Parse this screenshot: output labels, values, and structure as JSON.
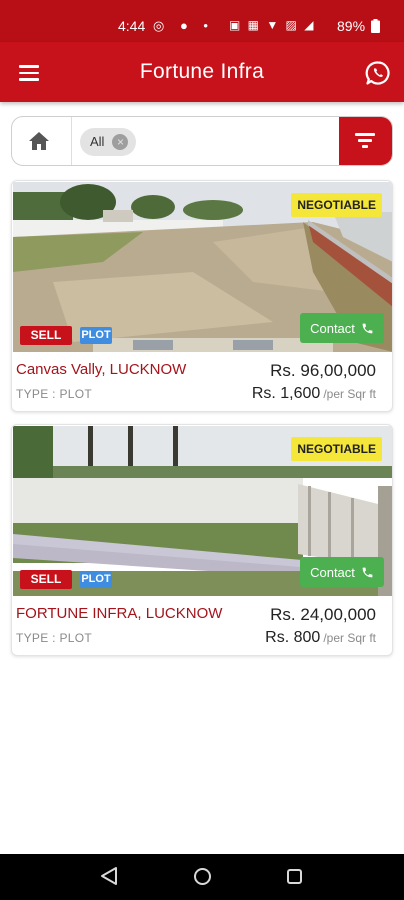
{
  "status_bar": {
    "time": "4:44",
    "left_icons": "◎ ● •",
    "right_icons": "▣ ▦ ▼ ▨ ◢",
    "battery": "89%"
  },
  "app_bar": {
    "title": "Fortune Infra"
  },
  "filter": {
    "chip_label": "All",
    "chip_close": "×"
  },
  "listings": [
    {
      "negotiable": "NEGOTIABLE",
      "sell": "SELL",
      "plot": "PLOT",
      "contact": "Contact",
      "title": "Canvas Vally, LUCKNOW",
      "type": "TYPE : PLOT",
      "price": "Rs. 96,00,000",
      "rate": "Rs. 1,600",
      "rate_unit": "/per Sqr ft"
    },
    {
      "negotiable": "NEGOTIABLE",
      "sell": "SELL",
      "plot": "PLOT",
      "contact": "Contact",
      "title": "FORTUNE INFRA, LUCKNOW",
      "type": "TYPE : PLOT",
      "price": "Rs. 24,00,000",
      "rate": "Rs. 800",
      "rate_unit": "/per Sqr ft"
    }
  ],
  "colors": {
    "brand_red": "#c8121b",
    "status_red": "#b80f16",
    "contact_green": "#4caf50",
    "negotiable_yellow": "#f5e63a",
    "plot_blue": "#3f8de0"
  },
  "icons": {
    "menu": "menu-icon",
    "whatsapp": "whatsapp-icon",
    "home": "home-icon",
    "filter": "filter-icon",
    "phone": "phone-icon",
    "nav_back": "back-triangle-icon",
    "nav_home": "home-circle-icon",
    "nav_recent": "recent-square-icon"
  }
}
